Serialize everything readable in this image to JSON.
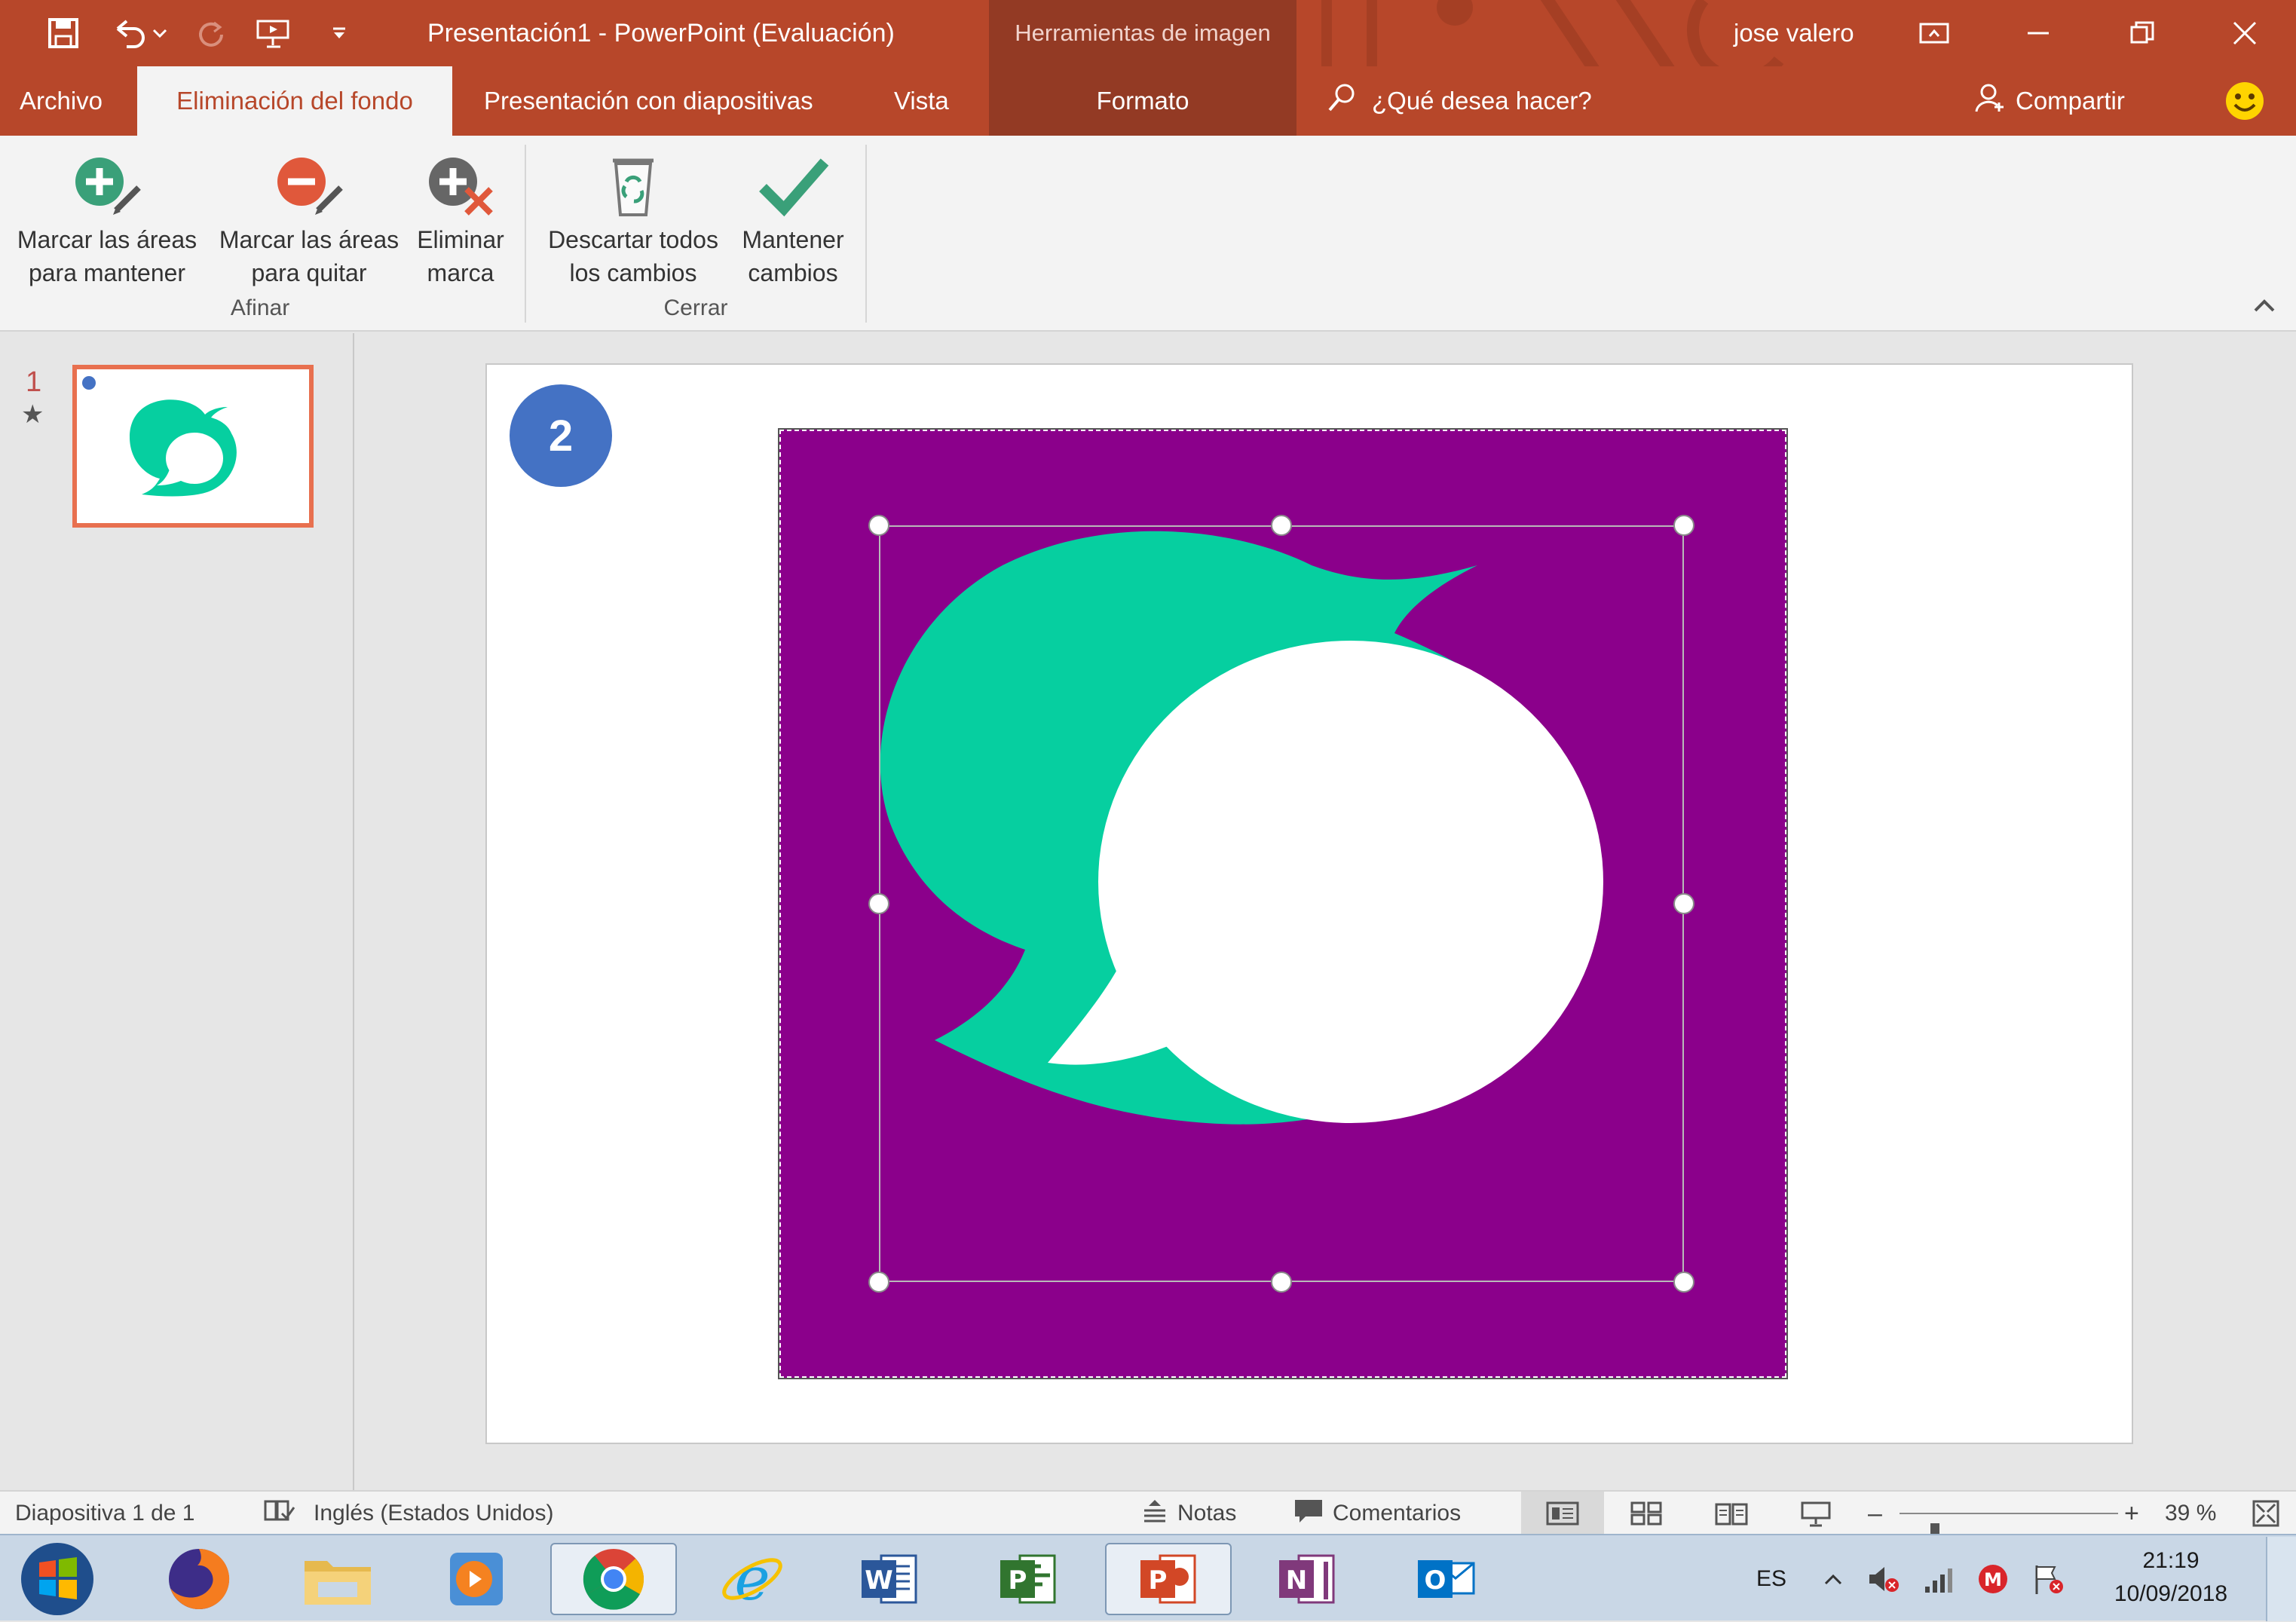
{
  "titlebar": {
    "title": "Presentación1  -  PowerPoint (Evaluación)",
    "context_label": "Herramientas de imagen",
    "user": "jose valero",
    "qat_icons": [
      "save-icon",
      "undo-icon",
      "redo-icon",
      "start-from-beginning-icon",
      "customize-qat-icon"
    ],
    "window_icons": [
      "ribbon-display-options-icon",
      "minimize-icon",
      "restore-icon",
      "close-icon"
    ]
  },
  "tabs": {
    "archivo": "Archivo",
    "eliminacion": "Eliminación del fondo",
    "presentacion": "Presentación con diapositivas",
    "vista": "Vista",
    "formato": "Formato",
    "tell_me": "¿Qué desea hacer?",
    "share": "Compartir"
  },
  "ribbon": {
    "groups": {
      "afinar": "Afinar",
      "cerrar": "Cerrar"
    },
    "buttons": {
      "mark_keep": [
        "Marcar las áreas",
        "para mantener"
      ],
      "mark_remove": [
        "Marcar las áreas",
        "para quitar"
      ],
      "delete_mark": [
        "Eliminar",
        "marca"
      ],
      "discard": [
        "Descartar todos",
        "los cambios"
      ],
      "keep": [
        "Mantener",
        "cambios"
      ]
    }
  },
  "thumbnails": {
    "slide_number": "1",
    "animation_marker": "★"
  },
  "slide": {
    "badge": "2"
  },
  "statusbar": {
    "slide_info": "Diapositiva 1 de 1",
    "language": "Inglés (Estados Unidos)",
    "notes": "Notas",
    "comments": "Comentarios",
    "zoom_minus": "–",
    "zoom_plus": "+",
    "zoom": "39 %",
    "zoom_level_percent": 39
  },
  "taskbar": {
    "apps": [
      "start",
      "firefox",
      "explorer",
      "media-player",
      "chrome",
      "internet-explorer",
      "word",
      "project",
      "powerpoint",
      "onenote",
      "outlook"
    ],
    "lang": "ES",
    "time": "21:19",
    "date": "10/09/2018"
  },
  "colors": {
    "accent": "#b7472a",
    "context": "#933a24",
    "picture_bg": "#8b008b",
    "logo": "#06cfa0",
    "badge": "#4472c4"
  }
}
